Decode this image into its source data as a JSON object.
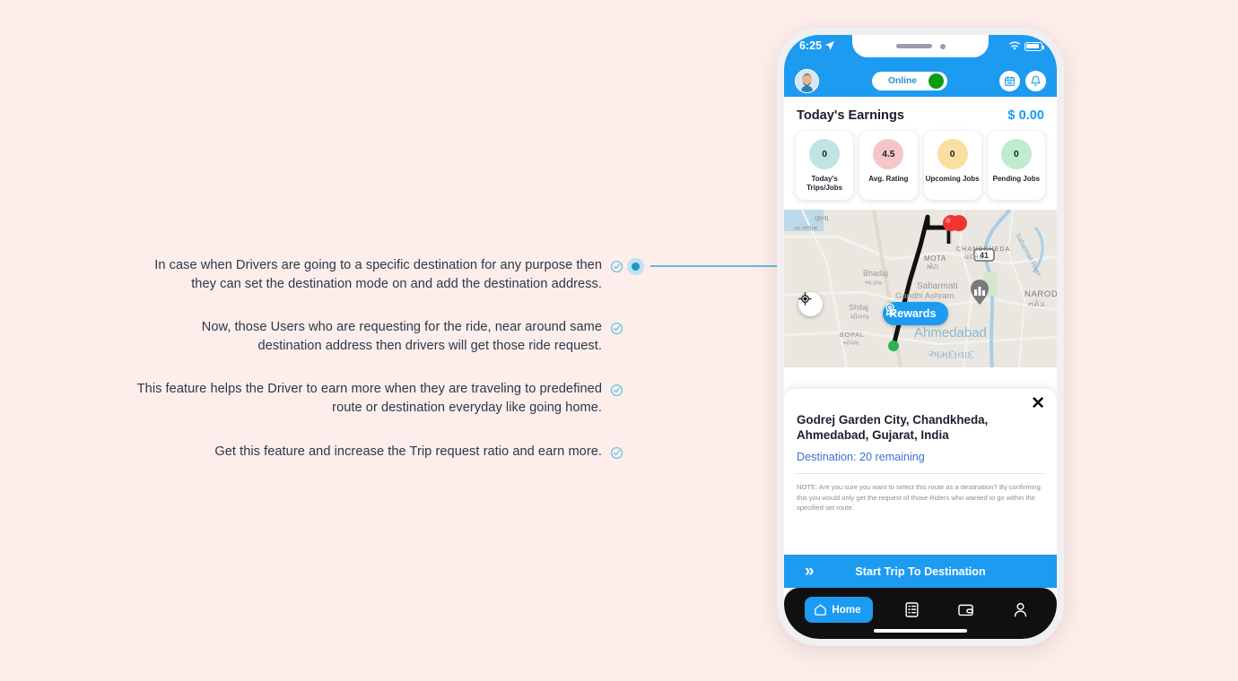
{
  "background_color": "#fdeeec",
  "accent_color": "#1c9bf0",
  "annotations": [
    {
      "text": "In case when Drivers are going to a specific destination for any purpose then they can set the destination mode on and add the destination address.",
      "icon": "check-circle-icon"
    },
    {
      "text": "Now, those Users who are requesting for the ride, near around same destination address then drivers will get those ride request.",
      "icon": "check-circle-icon"
    },
    {
      "text": "This feature helps the Driver to earn more when they are traveling to predefined route or destination everyday like going home.",
      "icon": "check-circle-icon"
    },
    {
      "text": "Get this feature and increase the Trip request ratio and earn more.",
      "icon": "check-circle-icon"
    }
  ],
  "phone": {
    "status_bar": {
      "time": "6:25",
      "location_icon": "location-arrow-icon",
      "wifi_icon": "wifi-icon",
      "battery_icon": "battery-icon"
    },
    "header": {
      "avatar": "user-avatar",
      "toggle_label": "Online",
      "toggle_state": "on",
      "calendar_icon": "calendar-icon",
      "bell_icon": "bell-icon"
    },
    "earnings": {
      "title": "Today's Earnings",
      "amount": "$ 0.00"
    },
    "stats": [
      {
        "value": "0",
        "label": "Today's Trips/Jobs",
        "color": "#bfe4e4"
      },
      {
        "value": "4.5",
        "label": "Avg. Rating",
        "color": "#f5c6c6"
      },
      {
        "value": "0",
        "label": "Upcoming Jobs",
        "color": "#fadfa1"
      },
      {
        "value": "0",
        "label": "Pending Jobs",
        "color": "#bfeccd"
      }
    ],
    "map": {
      "gps_icon": "gps-crosshair-icon",
      "rewards_label": "Rewards",
      "rewards_icon": "award-medal-icon",
      "pin_start_icon": "green-marker-icon",
      "pin_end_icon": "red-marker-icon",
      "labels": [
        "CHANDKHEDA",
        "ચાંદખેડા",
        "MOTA",
        "મોટા",
        "Bhadaj",
        "ભાડજ",
        "Shilaj",
        "શીલજ",
        "BOPAL",
        "બોપલ",
        "Sabarmati",
        "Gandhi Ashram",
        "Ahmedabad",
        "અમદાવાદ",
        "NAROD",
        "નરોડા",
        "Sabarmati River",
        "41",
        "ણાવા",
        "ન તળાવ"
      ]
    },
    "destination_card": {
      "close_icon": "close-x-icon",
      "title": "Godrej Garden City, Chandkheda, Ahmedabad, Gujarat, India",
      "subtitle": "Destination: 20 remaining",
      "note": "NOTE: Are you sure you want to select this route as a destination? By confirming this you would only get the request of those Riders who wanted to go within the specified set route.",
      "start_button_label": "Start Trip To Destination",
      "start_button_icon": "double-chevron-right-icon"
    },
    "bottom_nav": [
      {
        "label": "Home",
        "icon": "home-icon",
        "active": true
      },
      {
        "label": "",
        "icon": "list-icon",
        "active": false
      },
      {
        "label": "",
        "icon": "wallet-icon",
        "active": false
      },
      {
        "label": "",
        "icon": "person-icon",
        "active": false
      }
    ]
  }
}
